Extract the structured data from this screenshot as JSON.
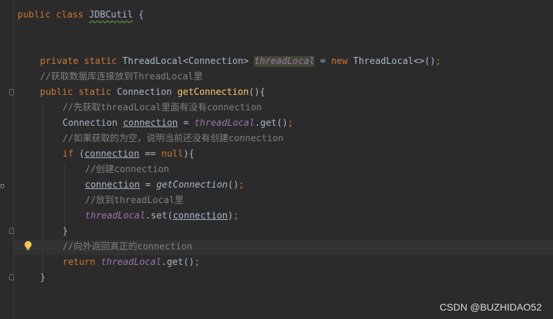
{
  "code": {
    "l1": {
      "kw": "public class ",
      "name": "JDBCutil",
      "rest": " {"
    },
    "l2": {
      "kw1": "private static ",
      "type": "ThreadLocal<Connection> ",
      "field": "threadLocal",
      "eq": " = ",
      "kw2": "new ",
      "ctor": "ThreadLocal<>()",
      "semi": ";"
    },
    "l3": {
      "comment": "//获取数据库连接放到ThreadLocal里"
    },
    "l4": {
      "kw": "public static ",
      "type": "Connection ",
      "method": "getConnection",
      "rest": "(){"
    },
    "l5": {
      "comment": "//先获取threadLocal里面有没有connection"
    },
    "l6": {
      "type": "Connection ",
      "var": "connection",
      "eq": " = ",
      "field": "threadLocal",
      "call": ".get()",
      "semi": ";"
    },
    "l7": {
      "comment": "//如果获取的为空，说明当前还没有创建connection"
    },
    "l8": {
      "kw": "if ",
      "open": "(",
      "var": "connection",
      "op": " == ",
      "kw2": "null",
      "close": "){"
    },
    "l9": {
      "comment": "//创建connection"
    },
    "l10": {
      "var": "connection",
      "eq": " = ",
      "method": "getConnection",
      "paren": "()",
      "semi": ";"
    },
    "l11": {
      "comment": "//放到threadLocal里"
    },
    "l12": {
      "field": "threadLocal",
      "call": ".set(",
      "var": "connection",
      "close": ")",
      "semi": ";"
    },
    "l13": {
      "brace": "}"
    },
    "l14": {
      "comment": "//向外返回真正的connection"
    },
    "l15": {
      "kw": "return ",
      "field": "threadLocal",
      "call": ".get()",
      "semi": ";"
    },
    "l16": {
      "brace": "}"
    }
  },
  "icons": {
    "bulb": "lightbulb-icon",
    "fold": "fold-marker-icon"
  },
  "colors": {
    "background": "#2b2b2b",
    "keyword": "#cc7832",
    "comment": "#808080",
    "method": "#ffc66d",
    "static_field": "#9876aa",
    "text": "#a9b7c6"
  },
  "watermark": "CSDN @BUZHIDAO52"
}
